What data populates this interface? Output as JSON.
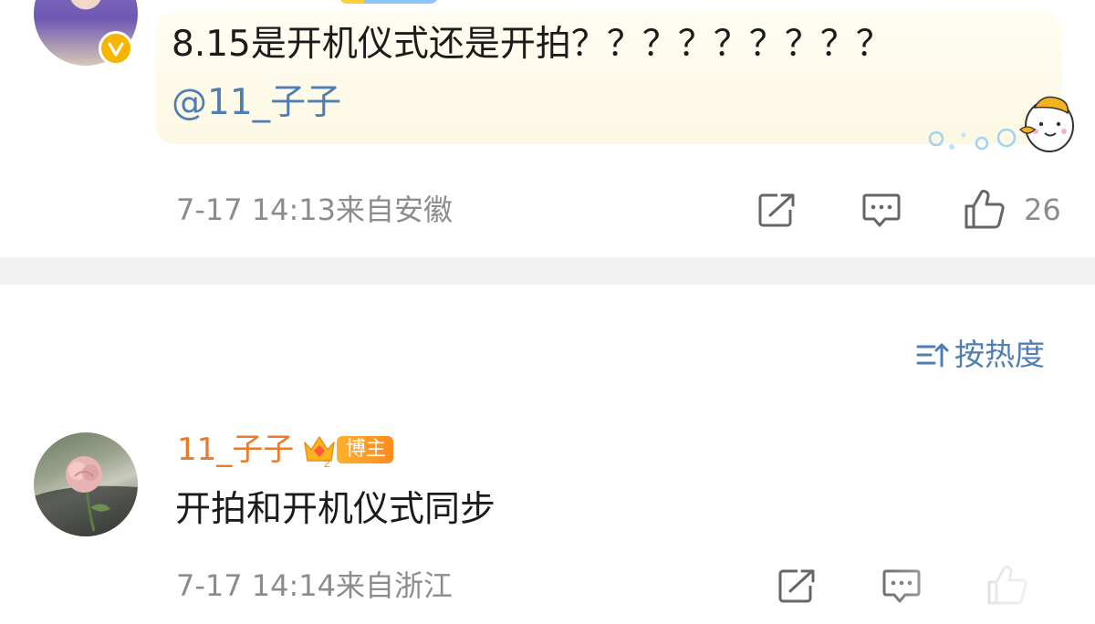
{
  "comments": [
    {
      "author": "",
      "verified": true,
      "text": "8.15是开机仪式还是开拍？？？？？？？？？",
      "mention": "@11_子子",
      "time": "7-17 14:13",
      "location": "来自安徽",
      "likes": "26"
    },
    {
      "author": "11_子子",
      "badge": "博主",
      "text": "开拍和开机仪式同步",
      "time": "7-17 14:14",
      "location": "来自浙江"
    }
  ],
  "sort": {
    "label": "按热度",
    "icon": "sort-icon"
  },
  "colors": {
    "name": "#e87a2c",
    "link": "#4f7eb2",
    "meta": "#8c8c8c",
    "divider": "#f1f1f1",
    "verified": "#f7b500",
    "badge": "#ff9a28"
  },
  "icons": [
    "verified-icon",
    "share-icon",
    "reply-icon",
    "like-icon",
    "sort-icon",
    "crown-icon"
  ]
}
